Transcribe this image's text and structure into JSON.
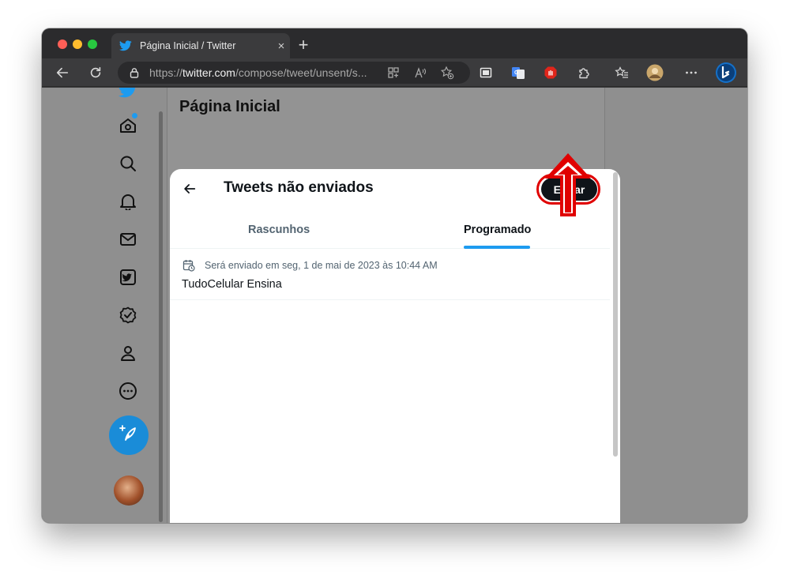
{
  "browser": {
    "tab_title": "Página Inicial / Twitter",
    "tab_close": "×",
    "new_tab": "+",
    "url_scheme": "https://",
    "url_host": "twitter.com",
    "url_path": "/compose/tweet/unsent/s..."
  },
  "page": {
    "heading": "Página Inicial"
  },
  "sidebar": {
    "items": [
      {
        "icon": "home-icon"
      },
      {
        "icon": "search-icon"
      },
      {
        "icon": "bell-icon"
      },
      {
        "icon": "mail-icon"
      },
      {
        "icon": "twitter-blue-icon"
      },
      {
        "icon": "verified-icon"
      },
      {
        "icon": "profile-icon"
      },
      {
        "icon": "more-icon"
      }
    ],
    "compose_icon": "feather-plus-icon"
  },
  "modal": {
    "title": "Tweets não enviados",
    "edit_label": "Editar",
    "tabs": [
      {
        "label": "Rascunhos",
        "active": false
      },
      {
        "label": "Programado",
        "active": true
      }
    ],
    "items": [
      {
        "schedule": "Será enviado em seg, 1 de mai de 2023 às 10:44 AM",
        "text": "TudoCelular Ensina"
      }
    ]
  },
  "colors": {
    "accent": "#1d9bf0",
    "annotation": "#e00000",
    "button_dark": "#0f1419"
  }
}
